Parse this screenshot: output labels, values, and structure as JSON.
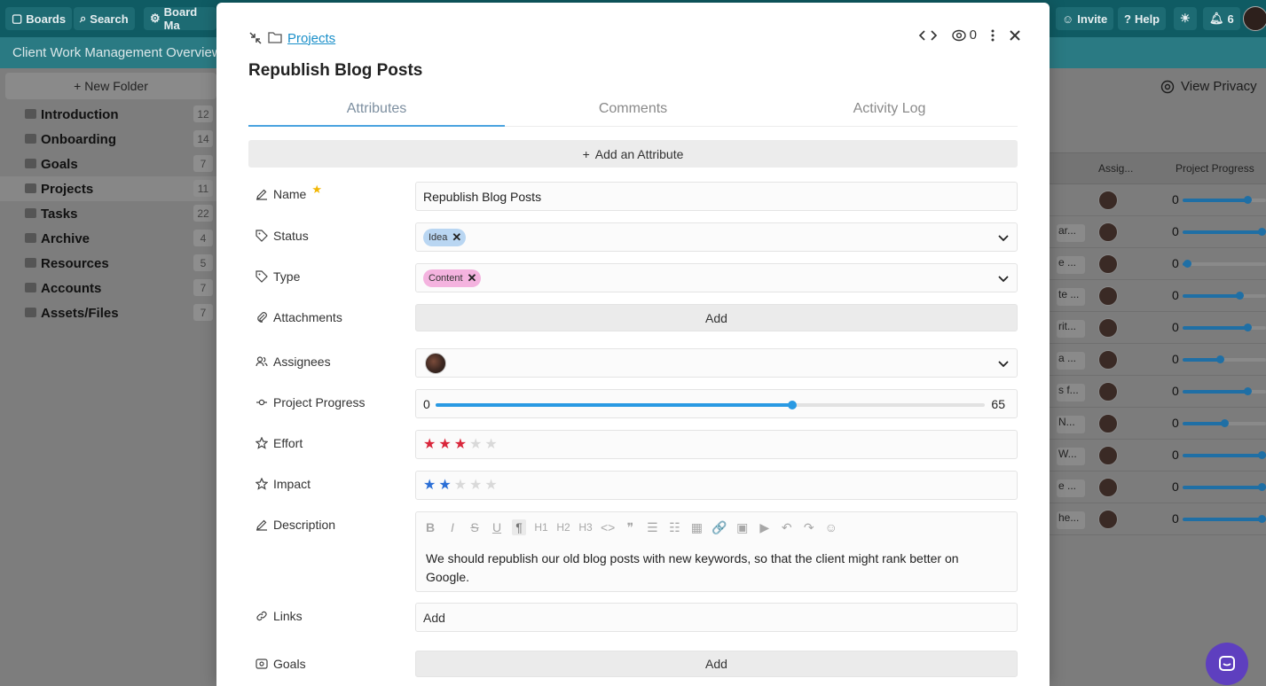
{
  "topbar": {
    "boards": "Boards",
    "search": "Search",
    "board_manager": "Board Ma",
    "invite": "Invite",
    "help": "Help",
    "notif_count": "6"
  },
  "subbar": {
    "title": "Client Work Management Overview"
  },
  "sidebar": {
    "new_folder": "New Folder",
    "folders": [
      {
        "label": "Introduction",
        "count": "12"
      },
      {
        "label": "Onboarding",
        "count": "14"
      },
      {
        "label": "Goals",
        "count": "7"
      },
      {
        "label": "Projects",
        "count": "11"
      },
      {
        "label": "Tasks",
        "count": "22"
      },
      {
        "label": "Archive",
        "count": "4"
      },
      {
        "label": "Resources",
        "count": "5"
      },
      {
        "label": "Accounts",
        "count": "7"
      },
      {
        "label": "Assets/Files",
        "count": "7"
      }
    ]
  },
  "rightpane": {
    "view_privacy": "View Privacy",
    "col_assignees": "Assig...",
    "col_progress": "Project Progress",
    "rows": [
      {
        "text": "",
        "num": "0",
        "progress": 0.78
      },
      {
        "text": "ar...",
        "num": "0",
        "progress": 0.95
      },
      {
        "text": "e ...",
        "num": "0",
        "progress": 0.05
      },
      {
        "text": "te ...",
        "num": "0",
        "progress": 0.68
      },
      {
        "text": "rit...",
        "num": "0",
        "progress": 0.78
      },
      {
        "text": "a ...",
        "num": "0",
        "progress": 0.45
      },
      {
        "text": "s f...",
        "num": "0",
        "progress": 0.78
      },
      {
        "text": "N...",
        "num": "0",
        "progress": 0.5
      },
      {
        "text": "W...",
        "num": "0",
        "progress": 1.0
      },
      {
        "text": "e ...",
        "num": "0",
        "progress": 1.0
      },
      {
        "text": "he...",
        "num": "0",
        "progress": 1.0
      }
    ]
  },
  "modal": {
    "breadcrumb": "Projects",
    "watchers": "0",
    "title": "Republish Blog Posts",
    "tabs": [
      {
        "label": "Attributes",
        "active": true
      },
      {
        "label": "Comments",
        "active": false
      },
      {
        "label": "Activity Log",
        "active": false
      }
    ],
    "add_attribute": "Add an Attribute",
    "fields": {
      "name": {
        "label": "Name",
        "value": "Republish Blog Posts"
      },
      "status": {
        "label": "Status",
        "tag": "Idea",
        "tag_color": "#b9d6f2"
      },
      "type": {
        "label": "Type",
        "tag": "Content",
        "tag_color": "#f4b3df"
      },
      "attachments": {
        "label": "Attachments",
        "button": "Add"
      },
      "assignees": {
        "label": "Assignees"
      },
      "progress": {
        "label": "Project Progress",
        "min": "0",
        "max": "65",
        "value": 0.65
      },
      "effort": {
        "label": "Effort",
        "rating": 3,
        "max": 5,
        "color": "#d9263b"
      },
      "impact": {
        "label": "Impact",
        "rating": 2,
        "max": 5,
        "color": "#2b6fd6"
      },
      "description": {
        "label": "Description",
        "toolbar": [
          "B",
          "I",
          "S",
          "U",
          "¶",
          "H1",
          "H2",
          "H3",
          "<>",
          "❞",
          "☰",
          "☷",
          "▦",
          "🔗",
          "▣",
          "▶",
          "↶",
          "↷",
          "☺"
        ],
        "text": "We should republish our old blog posts with new keywords, so that the client might rank better on Google."
      },
      "links": {
        "label": "Links",
        "placeholder": "Add"
      },
      "goals": {
        "label": "Goals",
        "button": "Add"
      }
    }
  }
}
